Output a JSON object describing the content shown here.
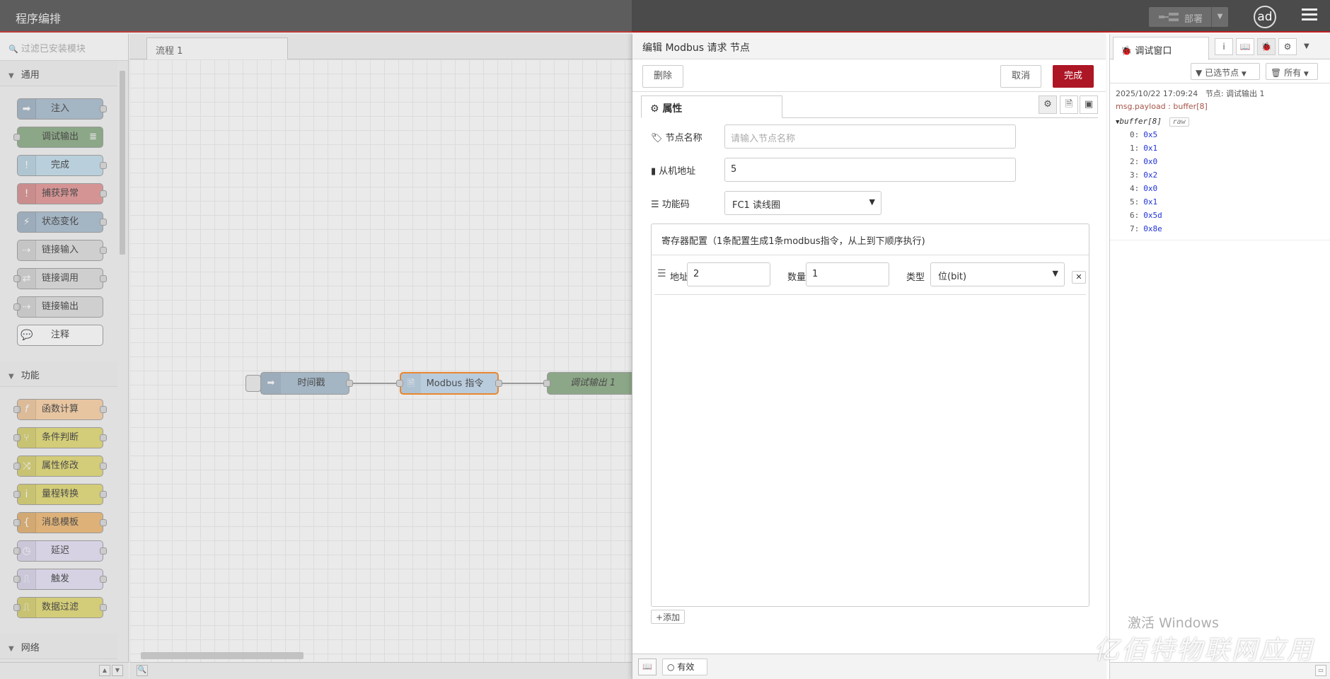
{
  "header": {
    "title": "程序编排",
    "deploy_label": "部署",
    "avatar_text": "ad"
  },
  "palette": {
    "search_placeholder": "过滤已安装模块",
    "categories": [
      {
        "label": "通用",
        "nodes": [
          {
            "label": "注入",
            "color": "#a6bbcf",
            "icon": "arrow-right-icon"
          },
          {
            "label": "调试输出",
            "color": "#87a980",
            "icon": "list-icon"
          },
          {
            "label": "完成",
            "color": "#c0deed",
            "icon": "exclamation-icon"
          },
          {
            "label": "捕获异常",
            "color": "#e49191",
            "icon": "exclamation-icon"
          },
          {
            "label": "状态变化",
            "color": "#a6bbcf",
            "icon": "pulse-icon"
          },
          {
            "label": "链接输入",
            "color": "#dddddd",
            "icon": "link-in-icon"
          },
          {
            "label": "链接调用",
            "color": "#dddddd",
            "icon": "link-call-icon"
          },
          {
            "label": "链接输出",
            "color": "#dddddd",
            "icon": "link-out-icon"
          },
          {
            "label": "注释",
            "color": "#ffffff",
            "icon": "comment-icon"
          }
        ]
      },
      {
        "label": "功能",
        "nodes": [
          {
            "label": "函数计算",
            "color": "#fdd0a2",
            "icon": "function-icon"
          },
          {
            "label": "条件判断",
            "color": "#e2d96e",
            "icon": "switch-icon"
          },
          {
            "label": "属性修改",
            "color": "#e2d96e",
            "icon": "change-icon"
          },
          {
            "label": "量程转换",
            "color": "#e2d96e",
            "icon": "range-icon"
          },
          {
            "label": "消息模板",
            "color": "#f0b66e",
            "icon": "template-icon"
          },
          {
            "label": "延迟",
            "color": "#e6e0f8",
            "icon": "timer-icon"
          },
          {
            "label": "触发",
            "color": "#e6e0f8",
            "icon": "trigger-icon"
          },
          {
            "label": "数据过滤",
            "color": "#e2d96e",
            "icon": "filter-icon"
          }
        ]
      },
      {
        "label": "网络",
        "nodes": []
      }
    ]
  },
  "workspace": {
    "tab_label": "流程 1",
    "flow_nodes": [
      {
        "label": "时间戳",
        "color": "#a6bbcf"
      },
      {
        "label": "Modbus 指令",
        "color": "#c0d9f0"
      },
      {
        "label": "调试输出 1",
        "color": "#87a980"
      }
    ]
  },
  "tray": {
    "title": "编辑 Modbus 请求 节点",
    "delete_label": "删除",
    "cancel_label": "取消",
    "done_label": "完成",
    "tab_label": "属性",
    "name_label": "节点名称",
    "name_placeholder": "请输入节点名称",
    "slave_label": "从机地址",
    "slave_value": "5",
    "func_label": "功能码",
    "func_value": "FC1 读线圈",
    "register_title": "寄存器配置（1条配置生成1条modbus指令，从上到下顺序执行)",
    "row": {
      "addr_label": "地址",
      "addr_value": "2",
      "qty_label": "数量",
      "qty_value": "1",
      "type_label": "类型",
      "type_value": "位(bit)"
    },
    "add_label": "添加",
    "enabled_label": "有效"
  },
  "sidebar": {
    "tab_label": "调试窗口",
    "filter_label": "已选节点",
    "clear_label": "所有",
    "message": {
      "timestamp": "2025/10/22 17:09:24",
      "node_label": "节点: 调试输出 1",
      "topic": "msg.payload : buffer[8]",
      "buffer_label": "buffer[8]",
      "raw_label": "raw",
      "entries": [
        {
          "k": "0:",
          "v": "0x5"
        },
        {
          "k": "1:",
          "v": "0x1"
        },
        {
          "k": "2:",
          "v": "0x0"
        },
        {
          "k": "3:",
          "v": "0x2"
        },
        {
          "k": "4:",
          "v": "0x0"
        },
        {
          "k": "5:",
          "v": "0x1"
        },
        {
          "k": "6:",
          "v": "0x5d"
        },
        {
          "k": "7:",
          "v": "0x8e"
        }
      ]
    }
  },
  "overlay": {
    "activate_text": "激活 Windows",
    "watermark_text": "亿佰特物联网应用"
  }
}
